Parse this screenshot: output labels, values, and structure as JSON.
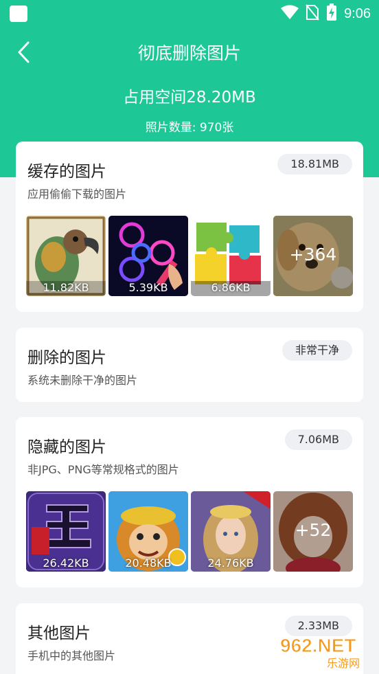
{
  "status_bar": {
    "time": "9:06",
    "icons": [
      "notification-square-icon",
      "wifi-icon",
      "no-sim-icon",
      "battery-charging-icon"
    ]
  },
  "header": {
    "back_icon": "chevron-left-icon",
    "title": "彻底删除图片"
  },
  "summary": {
    "used_space": "占用空间28.20MB",
    "photo_count": "照片数量: 970张"
  },
  "cards": {
    "cache": {
      "title": "缓存的图片",
      "subtitle": "应用偷偷下载的图片",
      "badge": "18.81MB",
      "thumbs": [
        {
          "size": "11.82KB",
          "icon": "parrot-art-image"
        },
        {
          "size": "5.39KB",
          "icon": "fidget-spinner-image"
        },
        {
          "size": "6.86KB",
          "icon": "puzzle-image"
        }
      ],
      "more": "+364"
    },
    "deleted": {
      "title": "删除的图片",
      "subtitle": "系统未删除干净的图片",
      "badge": "非常干净"
    },
    "hidden": {
      "title": "隐藏的图片",
      "subtitle": "非JPG、PNG等常规格式的图片",
      "badge": "7.06MB",
      "thumbs": [
        {
          "size": "26.42KB",
          "icon": "dragon-game-image"
        },
        {
          "size": "20.48KB",
          "icon": "monkey-king-game-image"
        },
        {
          "size": "24.76KB",
          "icon": "goddess-game-image"
        }
      ],
      "more": "+52"
    },
    "other": {
      "title": "其他图片",
      "subtitle": "手机中的其他图片",
      "badge": "2.33MB"
    }
  },
  "watermark": {
    "brand": "962.NET",
    "sub": "乐游网"
  },
  "colors": {
    "accent": "#1ec896",
    "background": "#f3f4f6",
    "badge_bg": "#eef0f3"
  }
}
